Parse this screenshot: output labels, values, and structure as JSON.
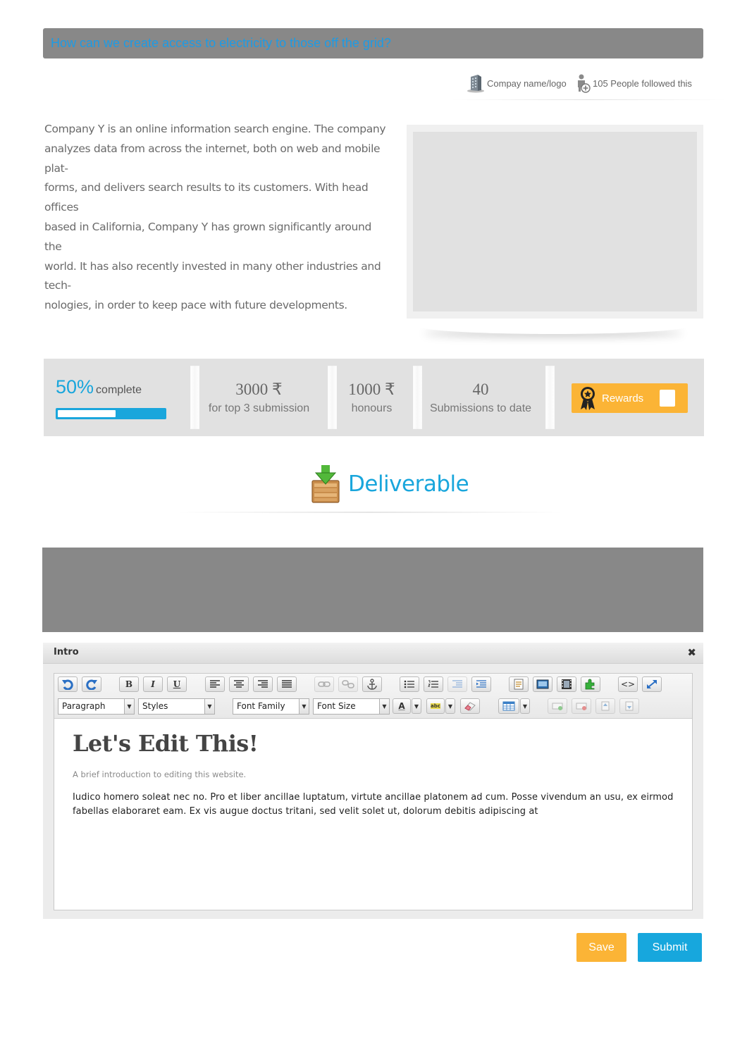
{
  "page": {
    "title": "How can we create access to electricity to those off the grid?"
  },
  "meta": {
    "company": "Compay name/logo",
    "followers": "105 People  followed this"
  },
  "description": [
    "Company Y is an online information search engine.  The company",
    "analyzes data from across the internet, both on web and mobile plat-",
    "forms, and delivers search results to its customers.  With head offices",
    "based in California, Company Y has grown significantly around the",
    "world.  It has also recently invested in many other industries and tech-",
    "nologies, in order to keep pace with future developments."
  ],
  "stats": {
    "progress_pct": "50%",
    "progress_word": "complete",
    "progress_value": 0.5,
    "prize_value": "3000 ₹",
    "prize_label": "for  top 3 submission",
    "honours_value": "1000 ₹",
    "honours_label": "honours",
    "submissions_value": "40",
    "submissions_label": "Submissions to date",
    "rewards_label": "Rewards"
  },
  "deliverable": {
    "heading": "Deliverable"
  },
  "editor": {
    "panel_title": "Intro",
    "close_glyph": "✖",
    "format_select": "Paragraph",
    "styles_select": "Styles",
    "font_family_select": "Font Family",
    "font_size_select": "Font Size",
    "heading": "Let's Edit This!",
    "lede": "A brief introduction to editing this website.",
    "body": "Iudico homero soleat nec no. Pro et liber ancillae luptatum, virtute ancillae platonem ad cum. Posse vivendum an usu, ex eirmod fabellas elaboraret eam. Ex vis augue doctus tritani, sed velit solet ut, dolorum debitis adipiscing at",
    "tools": {
      "bold": "B",
      "italic": "I",
      "underline": "U",
      "text_color": "A",
      "spellcheck": "abc",
      "source": "<>"
    },
    "icon_names": [
      "undo-icon",
      "redo-icon",
      "align-left-icon",
      "align-center-icon",
      "align-right-icon",
      "align-justify-icon",
      "link-icon",
      "unlink-icon",
      "anchor-icon",
      "bullet-list-icon",
      "numbered-list-icon",
      "outdent-icon",
      "indent-icon",
      "template-icon",
      "image-icon",
      "media-icon",
      "plugin-icon",
      "source-code-icon",
      "fullscreen-icon",
      "eraser-icon",
      "table-icon",
      "insert-row-icon",
      "delete-row-icon",
      "insert-col-before-icon",
      "insert-col-after-icon"
    ]
  },
  "actions": {
    "save": "Save",
    "submit": "Submit"
  },
  "colors": {
    "accent_blue": "#19a6dc",
    "accent_orange": "#fbb436",
    "title_blue": "#1e9be4",
    "panel_grey": "#888888"
  }
}
